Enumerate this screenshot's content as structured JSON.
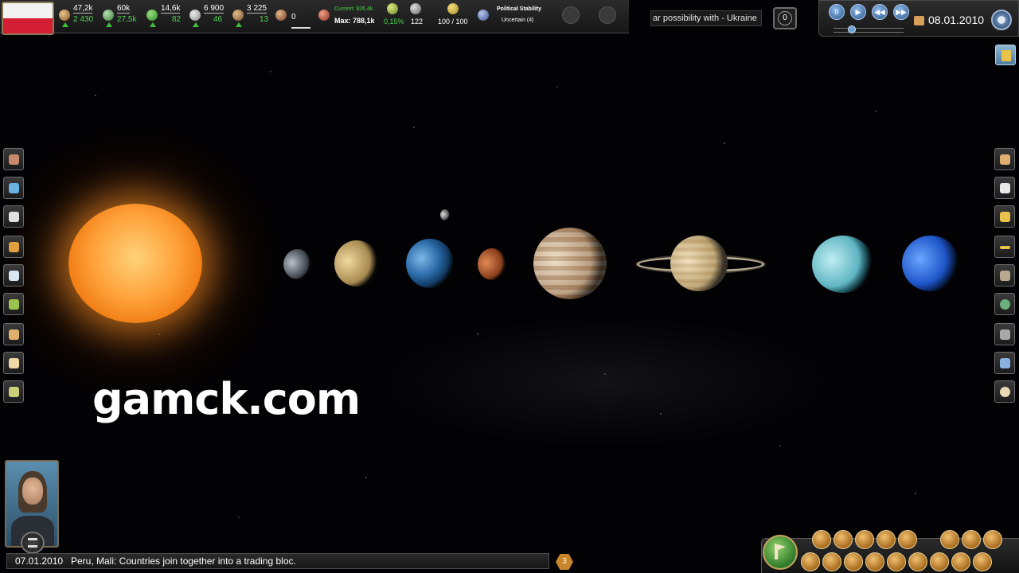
{
  "country": {
    "flag_colors": [
      "#f2f2f2",
      "#d41e34"
    ]
  },
  "stats": [
    {
      "icon": "money-icon",
      "value": "47,2k",
      "delta": "2 430"
    },
    {
      "icon": "population-icon",
      "value": "60k",
      "delta": "27,5k"
    },
    {
      "icon": "agriculture-icon",
      "value": "14,6k",
      "delta": "82"
    },
    {
      "icon": "livestock-icon",
      "value": "6 900",
      "delta": "46"
    },
    {
      "icon": "goods-icon",
      "value": "3 225",
      "delta": "13"
    }
  ],
  "military": {
    "value": "0"
  },
  "budget": {
    "current_label": "Current: 926,4k",
    "max_label": "Max: 788,1k"
  },
  "growth": {
    "value": "0,15%"
  },
  "research": {
    "value": "122"
  },
  "happiness": {
    "value": "100 / 100"
  },
  "stability": {
    "title": "Political Stability",
    "status": "Uncertain (4)"
  },
  "ticker": {
    "text": "ar possibility with - Ukraine"
  },
  "notifications": {
    "count": "0"
  },
  "time": {
    "date": "08.01.2010",
    "buttons": [
      "pause-icon",
      "play-icon",
      "rewind-icon",
      "fast-forward-icon"
    ],
    "pause_symbol": "II",
    "play_symbol": "▶",
    "rewind_symbol": "◀◀",
    "fast_forward_symbol": "▶▶"
  },
  "left_menu": [
    "diplomacy-icon",
    "economy-chart-icon",
    "population-icon",
    "trophy-icon",
    "research-icon",
    "laurel-icon",
    "buildings-icon",
    "scroll-icon",
    "map-icon"
  ],
  "right_menu": [
    "handshake-icon",
    "organization-icon",
    "leader-icon",
    "more-icon",
    "soldier-icon",
    "globe-icon",
    "spy-icon",
    "people-icon",
    "skull-icon"
  ],
  "watermark": "gamck.com",
  "news": {
    "date": "07.01.2010",
    "text": "Peru, Mali: Countries join together into a trading bloc.",
    "badge": "3"
  },
  "colors": {
    "accent_blue": "#2b5a8f",
    "gold": "#c9852a",
    "positive": "#4ed14e"
  }
}
